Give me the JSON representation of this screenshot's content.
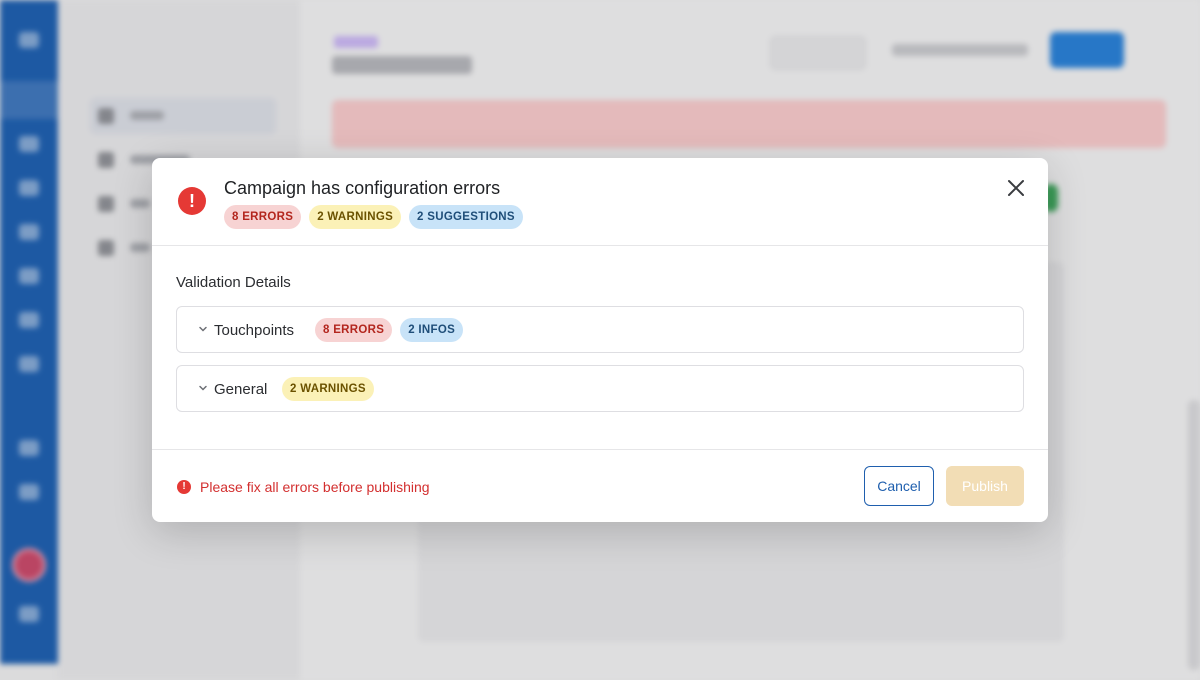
{
  "modal": {
    "title": "Campaign has configuration errors",
    "summary_badges": {
      "errors": "8 ERRORS",
      "warnings": "2 WARNINGS",
      "suggestions": "2 SUGGESTIONS"
    },
    "validation_title": "Validation Details",
    "sections": [
      {
        "label": "Touchpoints",
        "badges": {
          "errors": "8 ERRORS",
          "infos": "2 INFOS"
        }
      },
      {
        "label": "General",
        "badges": {
          "warnings": "2 WARNINGS"
        }
      }
    ],
    "footer": {
      "message": "Please fix all errors before publishing",
      "cancel_label": "Cancel",
      "publish_label": "Publish"
    }
  },
  "colors": {
    "error": "#e53935",
    "error_badge_bg": "#f7d3d3",
    "warning_badge_bg": "#fbf1b7",
    "info_badge_bg": "#c8e3f8",
    "primary": "#1f5fae",
    "publish_disabled": "#f2ddb5"
  },
  "icons": {
    "header": "error-circle-icon",
    "close": "close-icon",
    "chevron": "chevron-down-icon",
    "footer": "error-circle-icon"
  }
}
